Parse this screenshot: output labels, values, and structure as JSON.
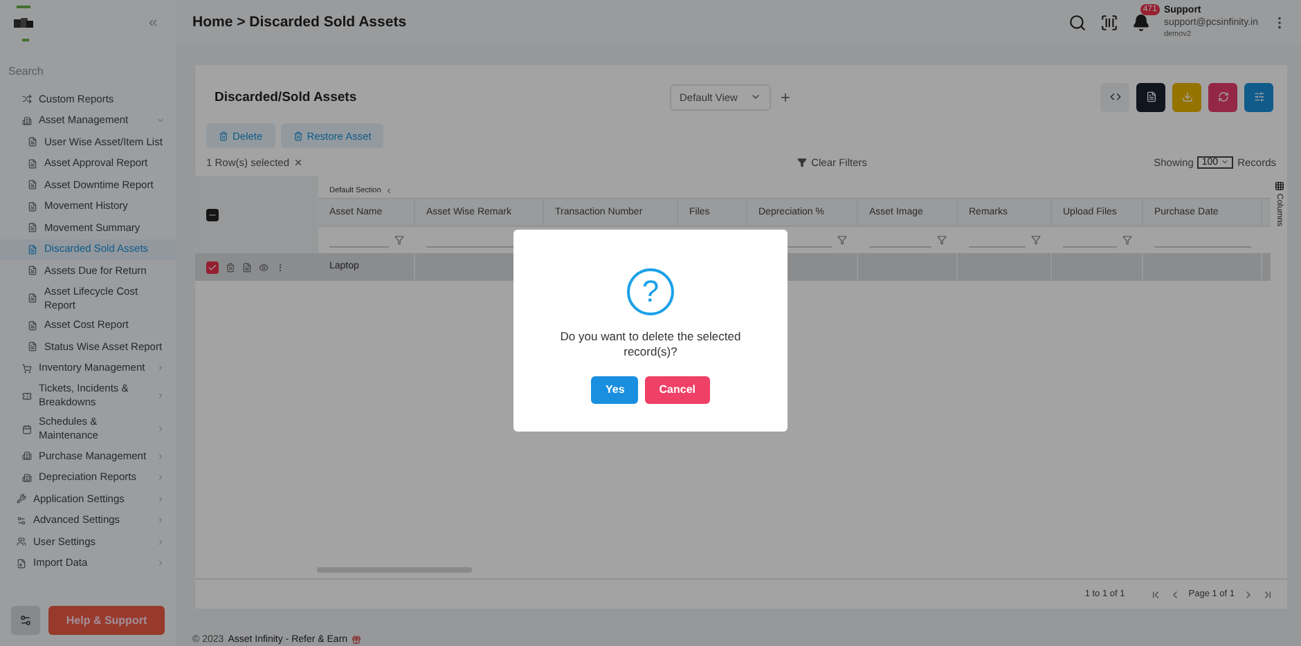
{
  "sidebar": {
    "search": {
      "placeholder": "Search"
    },
    "nested_items": [
      {
        "label": "Custom Reports",
        "kind": "custom",
        "selected": false
      },
      {
        "label": "Asset Management",
        "kind": "asset",
        "selected": false,
        "expanded": true,
        "children": [
          {
            "label": "User Wise Asset/Item List",
            "selected": false
          },
          {
            "label": "Asset Approval Report",
            "selected": false
          },
          {
            "label": "Asset Downtime Report",
            "selected": false
          },
          {
            "label": "Movement History",
            "selected": false
          },
          {
            "label": "Movement Summary",
            "selected": false
          },
          {
            "label": "Discarded Sold Assets",
            "selected": true
          },
          {
            "label": "Assets Due for Return",
            "selected": false
          },
          {
            "label": "Asset Lifecycle Cost Report",
            "selected": false
          },
          {
            "label": "Asset Cost Report",
            "selected": false
          },
          {
            "label": "Status Wise Asset Report",
            "selected": false
          }
        ]
      },
      {
        "label": "Inventory Management",
        "kind": "inventory",
        "selected": false,
        "expanded": false
      },
      {
        "label": "Tickets, Incidents & Breakdowns",
        "kind": "ticket",
        "selected": false,
        "expanded": false
      },
      {
        "label": "Schedules & Maintenance",
        "kind": "calendar",
        "selected": false,
        "expanded": false
      },
      {
        "label": "Purchase Management",
        "kind": "asset",
        "selected": false,
        "expanded": false
      },
      {
        "label": "Depreciation Reports",
        "kind": "building",
        "selected": false,
        "expanded": false
      }
    ],
    "items": [
      {
        "label": "Application Settings",
        "kind": "wrench",
        "selected": false,
        "expanded": false
      },
      {
        "label": "Advanced Settings",
        "kind": "gears",
        "selected": false,
        "expanded": false
      },
      {
        "label": "User Settings",
        "kind": "users",
        "selected": false,
        "expanded": false
      },
      {
        "label": "Import Data",
        "kind": "import",
        "selected": false,
        "expanded": false
      }
    ],
    "help_button": "Help & Support"
  },
  "header": {
    "breadcrumb": "Home > Discarded Sold Assets",
    "notification_count": "471",
    "user_name": "Support",
    "user_email": "support@pcsinfinity.in",
    "user_account": "demov2"
  },
  "card": {
    "title": "Discarded/Sold Assets",
    "view_select": "Default View",
    "tools": [
      {
        "kind": "code"
      },
      {
        "kind": "document"
      },
      {
        "kind": "download"
      },
      {
        "kind": "refresh"
      },
      {
        "kind": "settings"
      }
    ],
    "actions": [
      {
        "label": "Delete"
      },
      {
        "label": "Restore Asset"
      }
    ],
    "selection_text": "1 Row(s) selected",
    "clear_filters": "Clear Filters",
    "showing_label": "Showing",
    "page_size": "100",
    "records_label": "Records"
  },
  "table": {
    "section": "Default Section",
    "header_checkbox_indeterminate": true,
    "columns": [
      {
        "label": "Asset Name",
        "filter": true
      },
      {
        "label": "Asset Wise Remark"
      },
      {
        "label": "Transaction Number"
      },
      {
        "label": "Files"
      },
      {
        "label": "Depreciation %",
        "filter": true
      },
      {
        "label": "Asset Image",
        "filter": true
      },
      {
        "label": "Remarks",
        "filter": true
      },
      {
        "label": "Upload Files",
        "filter": true
      },
      {
        "label": "Purchase Date",
        "filter": false
      }
    ],
    "rows": [
      {
        "checked": true,
        "cells": [
          "Laptop"
        ]
      }
    ],
    "columns_panel": "Columns",
    "range": "1 to 1 of 1",
    "page": "Page 1 of 1"
  },
  "footer": {
    "copyright": "© 2023",
    "link": "Asset Infinity - Refer & Earn"
  },
  "dialog": {
    "icon_text": "?",
    "message": "Do you want to delete the selected record(s)?",
    "confirm": "Yes",
    "cancel": "Cancel"
  }
}
